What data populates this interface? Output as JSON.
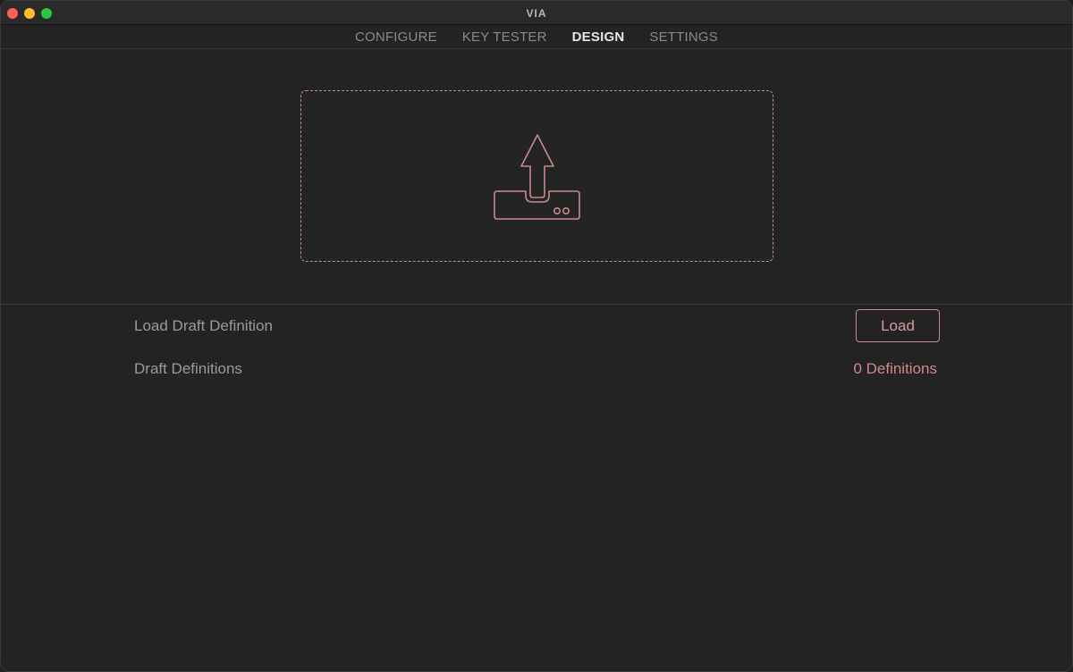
{
  "window": {
    "title": "VIA"
  },
  "nav": {
    "tabs": [
      {
        "label": "CONFIGURE",
        "active": false
      },
      {
        "label": "KEY TESTER",
        "active": false
      },
      {
        "label": "DESIGN",
        "active": true
      },
      {
        "label": "SETTINGS",
        "active": false
      }
    ]
  },
  "dropzone": {
    "icon": "upload-tray-icon"
  },
  "settings": {
    "load_draft_label": "Load Draft Definition",
    "load_button_label": "Load",
    "draft_definitions_label": "Draft Definitions",
    "draft_definitions_value": "0 Definitions"
  },
  "colors": {
    "accent": "#c98a8e",
    "accent_text": "#d2868e",
    "background": "#232323",
    "text_muted": "#9a9a9a",
    "tab_active": "#e6e6e6"
  }
}
